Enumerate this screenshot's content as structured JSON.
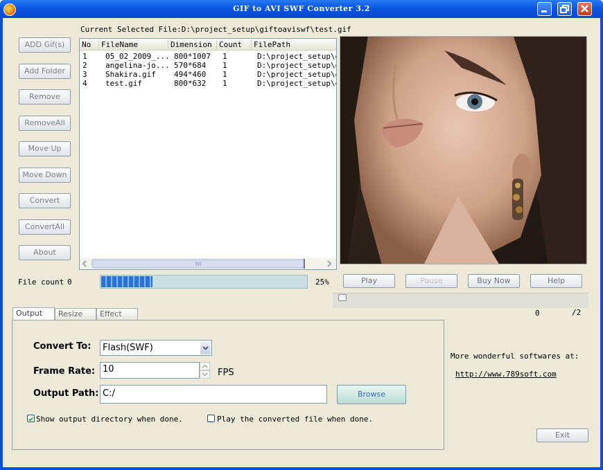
{
  "window": {
    "title": "GIF to AVI SWF Converter 3.2"
  },
  "current_file": {
    "label": "Current Selected File:D:\\project_setup\\giftoaviswf\\test.gif"
  },
  "side_buttons": [
    "ADD Gif(s)",
    "Add Folder",
    "Remove",
    "RemoveAll",
    "Move Up",
    "Move Down",
    "Convert",
    "ConvertAll",
    "About"
  ],
  "file_list": {
    "columns": [
      "No",
      "FileName",
      "Dimension",
      "Count",
      "FilePath"
    ],
    "rows": [
      {
        "no": "1",
        "name": "05_02_2009_...",
        "dim": "800*1007",
        "count": "1",
        "path": "D:\\project_setup\\gi"
      },
      {
        "no": "2",
        "name": "angelina-jo...",
        "dim": "570*684",
        "count": "1",
        "path": "D:\\project_setup\\gi"
      },
      {
        "no": "3",
        "name": "Shakira.gif",
        "dim": "494*460",
        "count": "1",
        "path": "D:\\project_setup\\gi"
      },
      {
        "no": "4",
        "name": "test.gif",
        "dim": "800*632",
        "count": "1",
        "path": "D:\\project_setup\\gi"
      }
    ]
  },
  "file_count": {
    "label": "File count",
    "value": "0"
  },
  "progress": {
    "percent_label": "25%",
    "value": 0.25
  },
  "player": {
    "play": "Play",
    "pause": "Pause",
    "buy_now": "Buy Now",
    "help": "Help",
    "frame": "0",
    "total": "/2"
  },
  "tabs": [
    "Output",
    "Resize",
    "Effect"
  ],
  "output": {
    "convert_to_label": "Convert To:",
    "convert_to_value": "Flash(SWF)",
    "frame_rate_label": "Frame Rate:",
    "frame_rate_value": "10",
    "fps_label": "FPS",
    "output_path_label": "Output Path:",
    "output_path_value": "C:/",
    "browse": "Browse",
    "show_output_dir": "Show output directory when done.",
    "play_converted": "Play the converted file when done."
  },
  "promo": {
    "text": "More wonderful softwares at:",
    "link": "http://www.789soft.com"
  },
  "exit": "Exit"
}
